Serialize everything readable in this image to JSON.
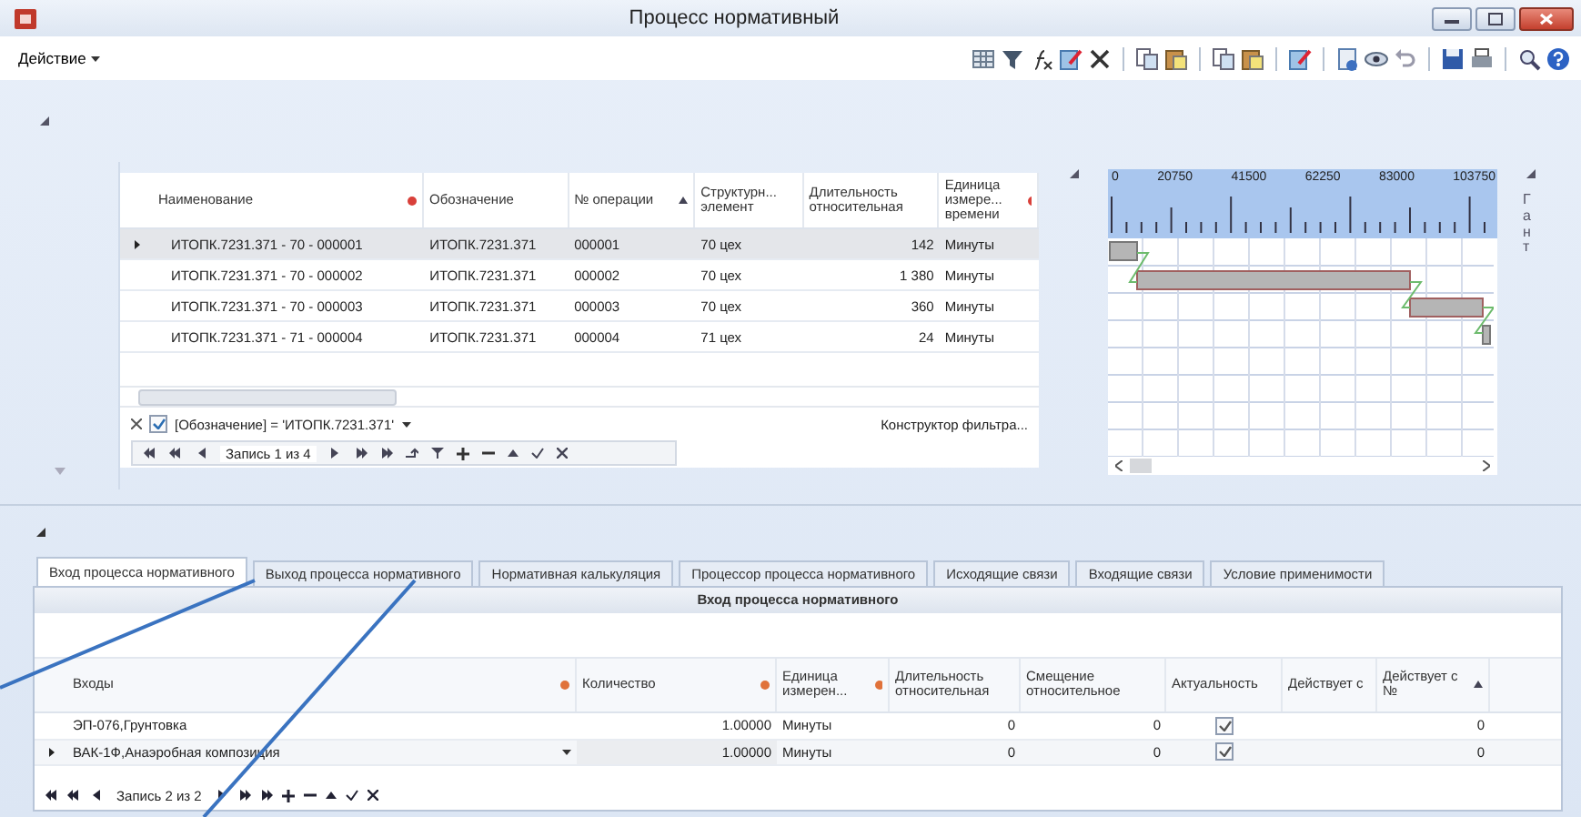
{
  "window": {
    "title": "Процесс нормативный"
  },
  "menu": {
    "label": "Действие"
  },
  "main_table": {
    "columns": [
      {
        "label": "Наименование",
        "filtered": true,
        "sorted": false
      },
      {
        "label": "Обозначение",
        "filtered": false,
        "sorted": false
      },
      {
        "label": "№ операции",
        "filtered": false,
        "sorted": true
      },
      {
        "label": "Структурн... элемент",
        "filtered": false,
        "sorted": false
      },
      {
        "label": "Длительность относительная",
        "filtered": false,
        "sorted": false
      },
      {
        "label": "Единица измере... времени",
        "filtered": true,
        "sorted": false
      }
    ],
    "rows": [
      {
        "cells": [
          "ИТОПК.7231.371 - 70 - 000001",
          "ИТОПК.7231.371",
          "000001",
          "70 цех",
          "142",
          "Минуты"
        ],
        "selected": true
      },
      {
        "cells": [
          "ИТОПК.7231.371 - 70 - 000002",
          "ИТОПК.7231.371",
          "000002",
          "70 цех",
          "1 380",
          "Минуты"
        ],
        "selected": false
      },
      {
        "cells": [
          "ИТОПК.7231.371 - 70 - 000003",
          "ИТОПК.7231.371",
          "000003",
          "70 цех",
          "360",
          "Минуты"
        ],
        "selected": false
      },
      {
        "cells": [
          "ИТОПК.7231.371 - 71 - 000004",
          "ИТОПК.7231.371",
          "000004",
          "71 цех",
          "24",
          "Минуты"
        ],
        "selected": false
      }
    ],
    "filter": {
      "checked": true,
      "text": "[Обозначение] = 'ИТОПК.7231.371'"
    },
    "filter_builder": "Конструктор фильтра...",
    "navigator": {
      "record": "Запись 1 из 4"
    }
  },
  "gantt": {
    "ticks": [
      "0",
      "20750",
      "41500",
      "62250",
      "83000",
      "103750"
    ],
    "side_label": "Гант"
  },
  "tabs": [
    {
      "label": "Вход процесса нормативного",
      "selected": true
    },
    {
      "label": "Выход процесса нормативного",
      "selected": false
    },
    {
      "label": "Нормативная калькуляция",
      "selected": false
    },
    {
      "label": "Процессор процесса нормативного",
      "selected": false
    },
    {
      "label": "Исходящие связи",
      "selected": false
    },
    {
      "label": "Входящие связи",
      "selected": false
    },
    {
      "label": "Условие применимости",
      "selected": false
    }
  ],
  "detail": {
    "title": "Вход процесса нормативного",
    "columns": [
      {
        "label": "Входы",
        "filtered": true,
        "sorted": false
      },
      {
        "label": "Количество",
        "filtered": true,
        "sorted": false
      },
      {
        "label": "Единица измерен...",
        "filtered": true,
        "sorted": false
      },
      {
        "label": "Длительность относительная",
        "filtered": false,
        "sorted": false
      },
      {
        "label": "Смещение относительное",
        "filtered": false,
        "sorted": false
      },
      {
        "label": "Актуальность",
        "filtered": false,
        "sorted": false
      },
      {
        "label": "Действует с",
        "filtered": false,
        "sorted": false
      },
      {
        "label": "Действует с №",
        "filtered": false,
        "sorted": true
      }
    ],
    "rows": [
      {
        "cells": [
          "ЭП-076,Грунтовка",
          "1.00000",
          "Минуты",
          "0",
          "0",
          "0"
        ],
        "actual": true,
        "selected": false
      },
      {
        "cells": [
          "ВАК-1Ф,Анаэробная композиция",
          "1.00000",
          "Минуты",
          "0",
          "0",
          "0"
        ],
        "actual": true,
        "selected": true
      }
    ],
    "navigator": {
      "record": "Запись 2 из 2"
    }
  }
}
